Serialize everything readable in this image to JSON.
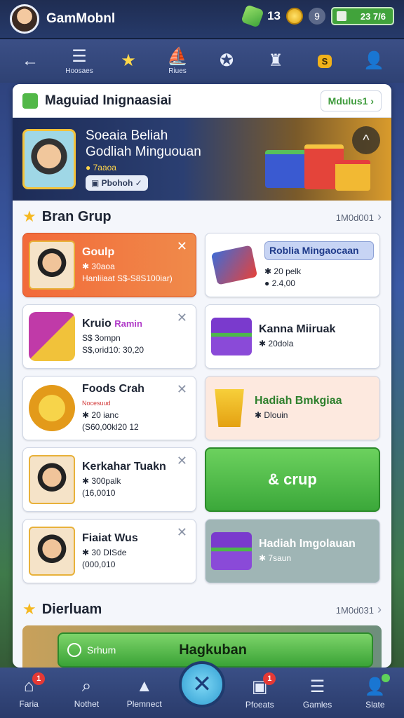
{
  "topbar": {
    "app_title": "GamMobnl",
    "gem_count": "13",
    "energy": "23 7/6",
    "settings_label": "9"
  },
  "navbar": {
    "items": [
      {
        "icon": "back-arrow-icon",
        "label": ""
      },
      {
        "icon": "list-icon",
        "label": "Hoosaes"
      },
      {
        "icon": "star-icon",
        "label": ""
      },
      {
        "icon": "ship-icon",
        "label": "Riues"
      },
      {
        "icon": "badge-icon",
        "label": ""
      },
      {
        "icon": "trophy-icon",
        "label": ""
      },
      {
        "icon": "cube-icon",
        "label": "S"
      },
      {
        "icon": "profile-icon",
        "label": ""
      }
    ]
  },
  "panel": {
    "title": "Maguiad Inignaasiai",
    "link": "Mdulus1"
  },
  "banner": {
    "title_line1": "Soeaia Beliah",
    "title_line2": "Godliah Minguouan",
    "coins": "7aaoa",
    "button": "Pbohoh"
  },
  "section1": {
    "title": "Bran Grup",
    "link": "1M0d001"
  },
  "cards": [
    {
      "title": "Goulp",
      "line1": "30aoa",
      "line2": "Hanliiaat S$-S8S100iar)"
    },
    {
      "pill": "Roblia Mingaocaan",
      "line1": "20 pelk",
      "line2": "2.4,00"
    },
    {
      "title": "Kruio",
      "badge": "Ramin",
      "line1": "S$ 3ompn",
      "line2": "S$,orid10: 30,20"
    },
    {
      "title": "Kanna Miiruak",
      "line1": "20dola"
    },
    {
      "title": "Foods Crah",
      "sub": "Nocesuud",
      "line1": "20 ianc",
      "line2": "(S60,00kl20 12"
    },
    {
      "title": "Hadiah Bmkgiaa",
      "line1": "Dlouin"
    },
    {
      "title": "Kerkahar Tuakn",
      "line1": "300palk",
      "line2": "(16,0010"
    },
    {
      "label": "& crup"
    },
    {
      "title": "Fiaiat Wus",
      "line1": "30 DISde",
      "line2": "(000,010"
    },
    {
      "title": "Hadiah Imgolauan",
      "line1": "7saun"
    }
  ],
  "section2": {
    "title": "Dierluam",
    "link": "1M0d031"
  },
  "promo": {
    "left": "Srhum",
    "center": "Hagkuban"
  },
  "tabbar": {
    "items": [
      {
        "icon": "home-icon",
        "label": "Faria",
        "badge": "1"
      },
      {
        "icon": "search-icon",
        "label": "Nothet"
      },
      {
        "icon": "shop-icon",
        "label": "Plemnect"
      },
      {
        "icon": "crossed-swords-icon",
        "label": ""
      },
      {
        "icon": "messages-icon",
        "label": "Pfoeats",
        "badge": "1"
      },
      {
        "icon": "games-icon",
        "label": "Gamles"
      },
      {
        "icon": "user-icon",
        "label": "Slate"
      }
    ]
  },
  "colors": {
    "accent_green": "#3ea43a",
    "nav_bg": "#2f4274",
    "card_orange": "#f26a3a"
  }
}
